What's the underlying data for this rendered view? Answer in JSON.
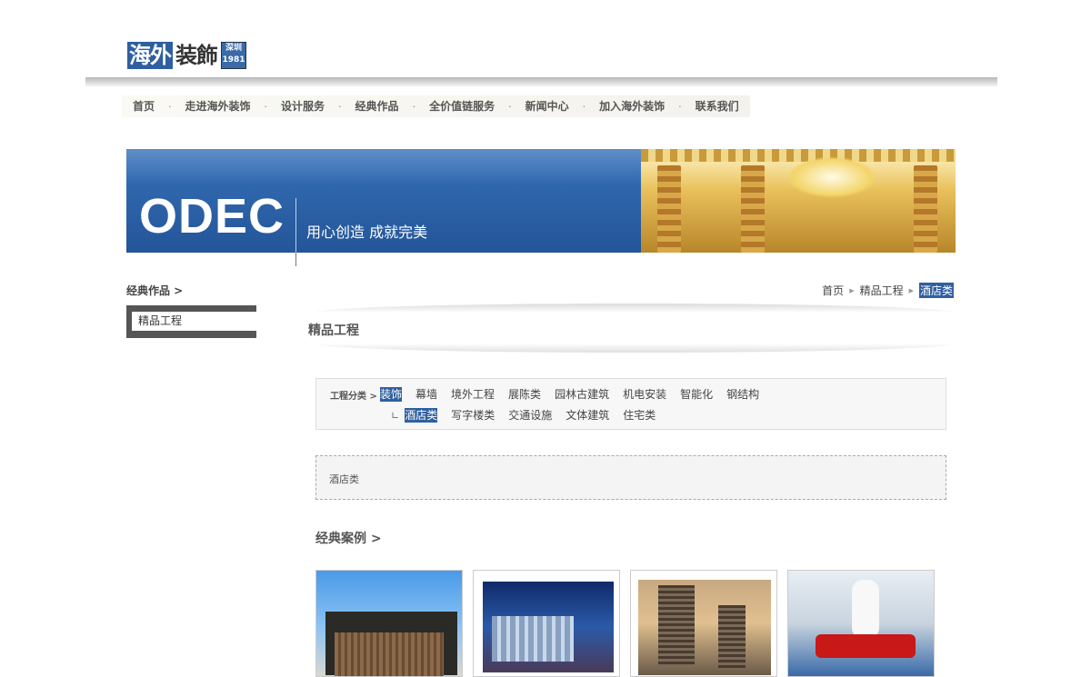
{
  "logo": {
    "part1": "海外",
    "part2": "装飾",
    "badge_line1": "深圳",
    "badge_line2": "1981"
  },
  "nav": {
    "items": [
      "首页",
      "走进海外装饰",
      "设计服务",
      "经典作品",
      "全价值链服务",
      "新闻中心",
      "加入海外装饰",
      "联系我们"
    ],
    "separator": "·"
  },
  "banner": {
    "brand": "ODEC",
    "slogan": "用心创造  成就完美"
  },
  "sidebar": {
    "title": "经典作品 >",
    "items": [
      "精品工程"
    ]
  },
  "breadcrumb": {
    "items": [
      "首页",
      "精品工程",
      "酒店类"
    ]
  },
  "main": {
    "title": "精品工程"
  },
  "categories": {
    "label": "工程分类 >",
    "row1": [
      "装饰",
      "幕墙",
      "境外工程",
      "展陈类",
      "园林古建筑",
      "机电安装",
      "智能化",
      "钢结构"
    ],
    "row1_active": "装饰",
    "sub_mark": "∟",
    "row2": [
      "酒店类",
      "写字楼类",
      "交通设施",
      "文体建筑",
      "住宅类"
    ],
    "row2_active": "酒店类"
  },
  "description": {
    "text": "酒店类"
  },
  "cases": {
    "title": "经典案例 >"
  },
  "colors": {
    "accent": "#2f5fa0",
    "sidebar_frame": "#555555"
  }
}
